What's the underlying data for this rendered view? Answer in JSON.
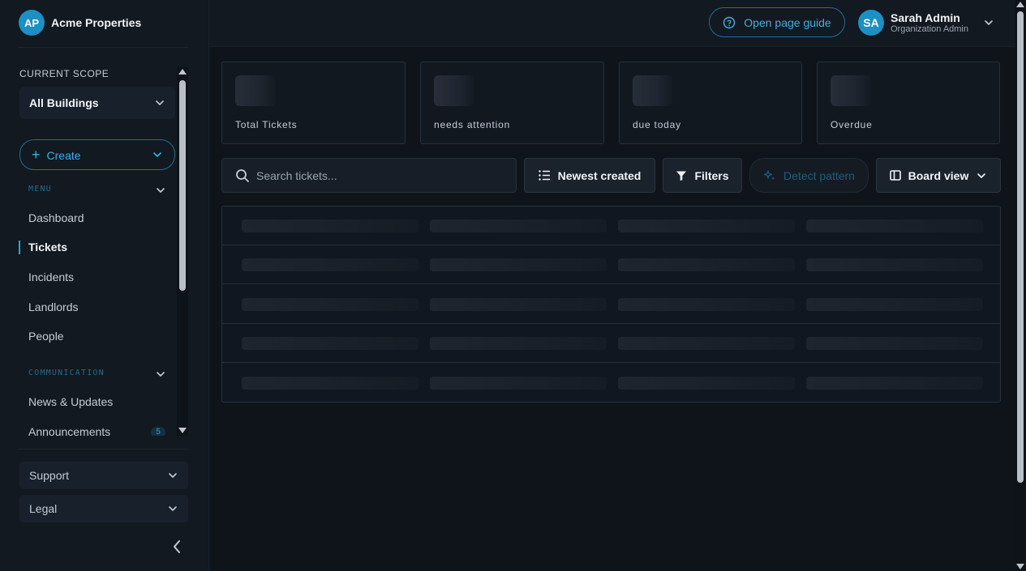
{
  "brand": {
    "initials": "AP",
    "name": "Acme Properties",
    "accent": "#1c8fc4"
  },
  "sidebar": {
    "scope_label": "CURRENT SCOPE",
    "scope_value": "All Buildings",
    "create_label": "Create",
    "sections": [
      {
        "title": "MENU",
        "items": [
          "Dashboard",
          "Tickets",
          "Incidents",
          "Landlords",
          "People"
        ]
      },
      {
        "title": "COMMUNICATION",
        "items": [
          "News & Updates",
          "Announcements"
        ]
      }
    ],
    "active_item": "Tickets",
    "announcements_badge": "5",
    "bottom": [
      "Support",
      "Legal"
    ]
  },
  "topbar": {
    "guide_label": "Open page guide",
    "user": {
      "initials": "SA",
      "name": "Sarah Admin",
      "role": "Organization Admin"
    }
  },
  "stats": [
    {
      "label": "Total Tickets"
    },
    {
      "label": "needs attention"
    },
    {
      "label": "due today"
    },
    {
      "label": "Overdue"
    }
  ],
  "toolbar": {
    "search_placeholder": "Search tickets...",
    "sort_label": "Newest created",
    "filters_label": "Filters",
    "detect_label": "Detect pattern",
    "view_label": "Board view"
  },
  "table": {
    "loading_rows": 5,
    "loading_columns": 4
  }
}
